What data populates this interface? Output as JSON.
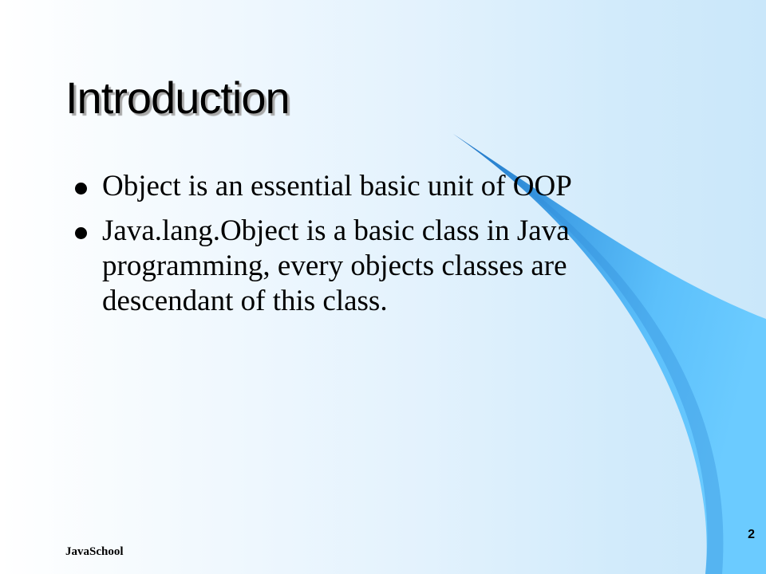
{
  "slide": {
    "title": "Introduction",
    "bullets": [
      "Object is an essential basic unit of OOP",
      "Java.lang.Object is a basic class in Java programming, every objects classes are descendant of this class."
    ],
    "footer_text": "JavaSchool",
    "page_number": "2"
  },
  "colors": {
    "background_light": "#ffffff",
    "background_blue": "#cae7fa",
    "swoosh_dark": "#1e78c8",
    "swoosh_light": "#66c8ff"
  }
}
